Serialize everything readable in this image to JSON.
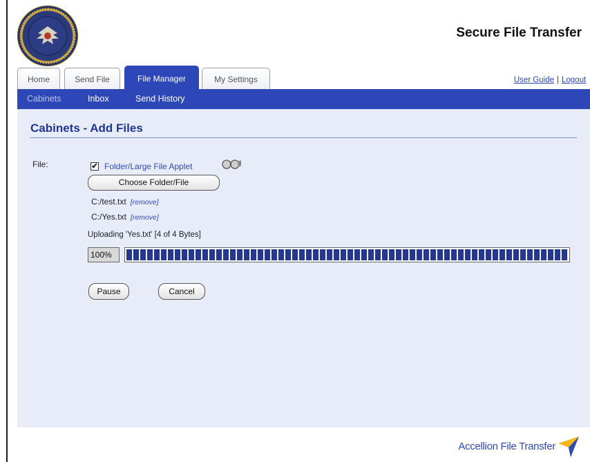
{
  "header": {
    "app_title": "Secure File Transfer",
    "seal_alt": "seal"
  },
  "tabs": [
    {
      "label": "Home",
      "active": false
    },
    {
      "label": "Send File",
      "active": false
    },
    {
      "label": "File Manager",
      "active": true
    },
    {
      "label": "My Settings",
      "active": false
    }
  ],
  "top_links": {
    "user_guide": "User Guide",
    "separator": "|",
    "logout": "Logout"
  },
  "subnav": {
    "items": [
      {
        "label": "Cabinets",
        "active": true
      },
      {
        "label": "Inbox",
        "active": false
      },
      {
        "label": "Send History",
        "active": false
      }
    ]
  },
  "main": {
    "page_title": "Cabinets - Add Files",
    "file_label": "File:",
    "applet_checked": true,
    "applet_checkbox_mark": "✔",
    "applet_link": "Folder/Large File Applet",
    "choose_button": "Choose Folder/File",
    "files": [
      {
        "path": "C:/test.txt",
        "remove_label": "[remove]"
      },
      {
        "path": "C:/Yes.txt",
        "remove_label": "[remove]"
      }
    ],
    "upload_status": "Uploading 'Yes.txt' [4 of 4 Bytes]",
    "progress_percent": "100%",
    "progress_fraction": 1.0,
    "pause_button": "Pause",
    "cancel_button": "Cancel"
  },
  "footer": {
    "brand": "Accellion File Transfer"
  },
  "colors": {
    "accent_blue": "#2d47b8",
    "panel_bg": "#e7ecf8",
    "link_blue": "#2f4ab3",
    "progress_blue": "#25378f"
  }
}
